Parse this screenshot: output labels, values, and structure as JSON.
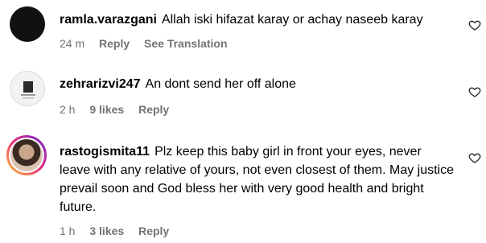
{
  "comments": [
    {
      "username": "ramla.varazgani",
      "text": "Allah iski hifazat karay or achay naseeb karay",
      "time": "24 m",
      "likes": "",
      "reply_label": "Reply",
      "translation_label": "See Translation",
      "like_icon": "heart-outline-icon"
    },
    {
      "username": "zehrarizvi247",
      "text": "An dont send her off alone",
      "time": "2 h",
      "likes": "9 likes",
      "reply_label": "Reply",
      "like_icon": "heart-outline-icon"
    },
    {
      "username": "rastogismita11",
      "text": "Plz keep this baby girl in front your eyes, never leave with any relative of yours, not even closest of them. May justice prevail soon and God bless her with very good health and bright future.",
      "time": "1 h",
      "likes": "3 likes",
      "reply_label": "Reply",
      "like_icon": "heart-outline-icon"
    }
  ],
  "colors": {
    "text": "#000000",
    "meta": "#737373",
    "story_ring_start": "#f9ce34",
    "story_ring_mid": "#ee2a7b",
    "story_ring_end": "#6228d7"
  }
}
